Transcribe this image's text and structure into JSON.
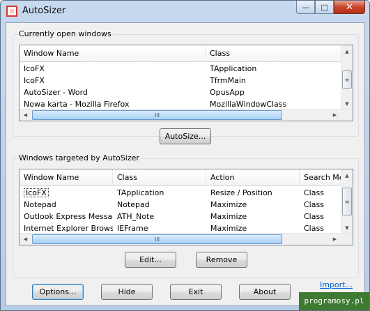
{
  "window": {
    "title": "AutoSizer"
  },
  "caption": {
    "minimize": "—",
    "maximize": "□",
    "close": "✕"
  },
  "open_group": {
    "label": "Currently open windows",
    "columns": [
      "Window Name",
      "Class"
    ],
    "rows": [
      [
        "IcoFX",
        "TApplication"
      ],
      [
        "IcoFX",
        "TfrmMain"
      ],
      [
        "AutoSizer - Word",
        "OpusApp"
      ],
      [
        "Nowa karta - Mozilla Firefox",
        "MozillaWindowClass"
      ]
    ],
    "autosize_button": "AutoSize..."
  },
  "targeted_group": {
    "label": "Windows targeted by AutoSizer",
    "columns": [
      "Window Name",
      "Class",
      "Action",
      "Search Me"
    ],
    "rows": [
      [
        "IcoFX",
        "TApplication",
        "Resize / Position",
        "Class"
      ],
      [
        "Notepad",
        "Notepad",
        "Maximize",
        "Class"
      ],
      [
        "Outlook Express Message",
        "ATH_Note",
        "Maximize",
        "Class"
      ],
      [
        "Internet Explorer Browser",
        "IEFrame",
        "Maximize",
        "Class"
      ]
    ],
    "edit_button": "Edit...",
    "remove_button": "Remove"
  },
  "footer": {
    "options_button": "Options...",
    "hide_button": "Hide",
    "exit_button": "Exit",
    "about_button": "About",
    "import_link": "Import..."
  },
  "watermark": "programosy.pl",
  "scroll_glyphs": {
    "up": "▲",
    "down": "▼",
    "left": "◀",
    "right": "▶",
    "grip_v": "≡",
    "grip_h": "III"
  }
}
